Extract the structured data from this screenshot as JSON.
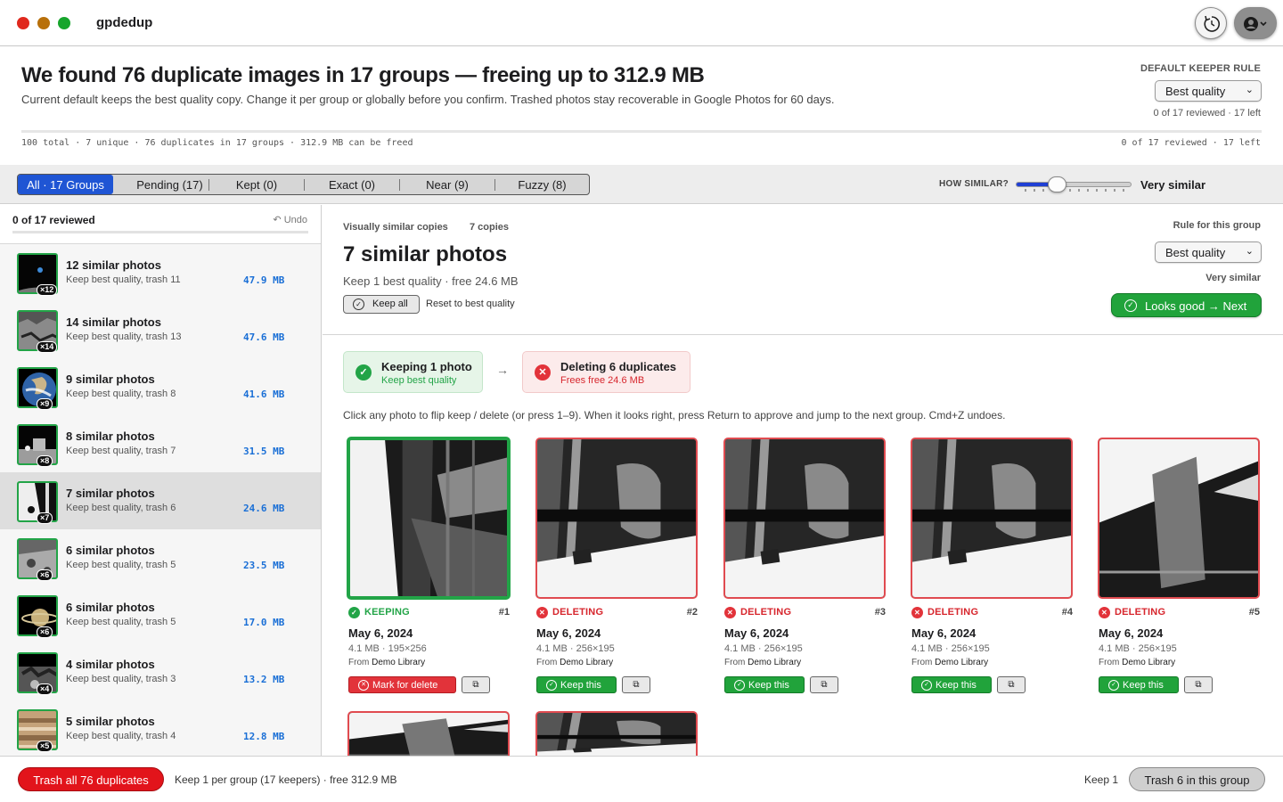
{
  "window": {
    "title": "gpdedup"
  },
  "summary": {
    "headline": "We found 76 duplicate images in 17 groups — freeing up to 312.9 MB",
    "subline": "Current default keeps the best quality copy. Change it per group or globally before you confirm. Trashed photos stay recoverable in Google Photos for 60 days.",
    "keeper_rule_label": "DEFAULT KEEPER RULE",
    "keeper_rule_value": "Best quality",
    "reviewed": "0 of 17 reviewed · 17 left",
    "stats_left": "100 total · 7 unique · 76 duplicates in 17 groups · 312.9 MB can be freed",
    "stats_right": "0 of 17 reviewed · 17 left",
    "progress": 0
  },
  "filters": {
    "tabs": [
      "All · 17 Groups",
      "Pending (17)",
      "Kept (0)",
      "Exact (0)",
      "Near (9)",
      "Fuzzy (8)"
    ],
    "active": 0,
    "similarity_label": "HOW SIMILAR?",
    "similarity_value": "Very similar"
  },
  "sidebar": {
    "reviewed": "0 of 17 reviewed",
    "undo": "Undo",
    "groups": [
      {
        "title": "12 similar photos",
        "sub": "Keep best quality, trash 11",
        "size": "47.9 MB",
        "badge": "×12",
        "thumb": "space"
      },
      {
        "title": "14 similar photos",
        "sub": "Keep best quality, trash 13",
        "size": "47.6 MB",
        "badge": "×14",
        "thumb": "rocks"
      },
      {
        "title": "9 similar photos",
        "sub": "Keep best quality, trash 8",
        "size": "41.6 MB",
        "badge": "×9",
        "thumb": "earth"
      },
      {
        "title": "8 similar photos",
        "sub": "Keep best quality, trash 7",
        "size": "31.5 MB",
        "badge": "×8",
        "thumb": "lunar"
      },
      {
        "title": "7 similar photos",
        "sub": "Keep best quality, trash 6",
        "size": "24.6 MB",
        "badge": "×7",
        "thumb": "bw"
      },
      {
        "title": "6 similar photos",
        "sub": "Keep best quality, trash 5",
        "size": "23.5 MB",
        "badge": "×6",
        "thumb": "moon"
      },
      {
        "title": "6 similar photos",
        "sub": "Keep best quality, trash 5",
        "size": "17.0 MB",
        "badge": "×6",
        "thumb": "saturn"
      },
      {
        "title": "4 similar photos",
        "sub": "Keep best quality, trash 3",
        "size": "13.2 MB",
        "badge": "×4",
        "thumb": "lunar2"
      },
      {
        "title": "5 similar photos",
        "sub": "Keep best quality, trash 4",
        "size": "12.8 MB",
        "badge": "×5",
        "thumb": "jupiter"
      }
    ],
    "selected": 4
  },
  "group": {
    "kind": "Visually similar copies",
    "copies": "7 copies",
    "title": "7 similar photos",
    "desc": "Keep 1 best quality · free 24.6 MB",
    "keep_all": "Keep all",
    "reset": "Reset to best quality",
    "rule_label": "Rule for this group",
    "rule_value": "Best quality",
    "similarity": "Very similar",
    "next": "Looks good → Next",
    "keeping_title": "Keeping 1 photo",
    "keeping_sub": "Keep best quality",
    "deleting_title": "Deleting 6 duplicates",
    "deleting_sub": "Frees free 24.6 MB",
    "instructions": "Click any photo to flip keep / delete (or press 1–9). When it looks right, press Return to approve and jump to the next group. Cmd+Z undoes."
  },
  "photos": [
    {
      "status": "KEEPING",
      "num": "#1",
      "date": "May 6, 2024",
      "meta": "4.1 MB · 195×256",
      "from_label": "From",
      "from": "Demo Library",
      "action": "Mark for delete",
      "kind": "keep"
    },
    {
      "status": "DELETING",
      "num": "#2",
      "date": "May 6, 2024",
      "meta": "4.1 MB · 256×195",
      "from_label": "From",
      "from": "Demo Library",
      "action": "Keep this",
      "kind": "del"
    },
    {
      "status": "DELETING",
      "num": "#3",
      "date": "May 6, 2024",
      "meta": "4.1 MB · 256×195",
      "from_label": "From",
      "from": "Demo Library",
      "action": "Keep this",
      "kind": "del"
    },
    {
      "status": "DELETING",
      "num": "#4",
      "date": "May 6, 2024",
      "meta": "4.1 MB · 256×195",
      "from_label": "From",
      "from": "Demo Library",
      "action": "Keep this",
      "kind": "del"
    },
    {
      "status": "DELETING",
      "num": "#5",
      "date": "May 6, 2024",
      "meta": "4.1 MB · 256×195",
      "from_label": "From",
      "from": "Demo Library",
      "action": "Keep this",
      "kind": "del"
    }
  ],
  "bottom": {
    "trash_all": "Trash all 76 duplicates",
    "info": "Keep 1 per group (17 keepers) · free 312.9 MB",
    "keep1": "Keep 1",
    "trash_group": "Trash 6 in this group"
  },
  "colors": {
    "accent": "#1f55d4",
    "keep": "#22a447",
    "delete": "#e2333a",
    "size": "#1a6fd6"
  }
}
